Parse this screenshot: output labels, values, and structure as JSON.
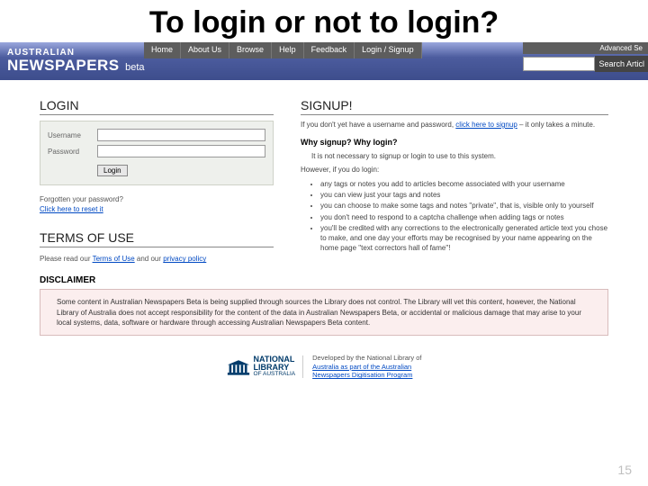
{
  "slide_title": "To login or not to login?",
  "brand": {
    "line1": "AUSTRALIAN",
    "line2": "NEWSPAPERS",
    "beta": "beta"
  },
  "nav": [
    "Home",
    "About Us",
    "Browse",
    "Help",
    "Feedback",
    "Login / Signup"
  ],
  "header_right": {
    "advanced": "Advanced Se",
    "search_btn": "Search Articl"
  },
  "login": {
    "title": "LOGIN",
    "username_label": "Username",
    "password_label": "Password",
    "login_btn": "Login",
    "forgot_q": "Forgotten your password?",
    "forgot_link": "Click here to reset it"
  },
  "terms": {
    "title": "TERMS OF USE",
    "prefix": "Please read our ",
    "link1": "Terms of Use",
    "mid": " and our ",
    "link2": "privacy policy"
  },
  "signup": {
    "title": "SIGNUP!",
    "intro_prefix": "If you don't yet have a username and password, ",
    "intro_link": "click here to signup",
    "intro_suffix": " – it only takes a minute.",
    "why_title": "Why signup? Why login?",
    "not_necessary": "It is not necessary to signup or login to use to this system.",
    "however": "However, if you do login:",
    "benefits": [
      "any tags or notes you add to articles become associated with your username",
      "you can view just your tags and notes",
      "you can choose to make some tags and notes \"private\", that is, visible only to yourself",
      "you don't need to respond to a captcha challenge when adding tags or notes",
      "you'll be credited with any corrections to the electronically generated article text you chose to make, and one day your efforts may be recognised by your name appearing on the home page \"text correctors hall of fame\"!"
    ]
  },
  "disclaimer": {
    "label": "DISCLAIMER",
    "text": "Some content in Australian Newspapers Beta is being supplied through sources the Library does not control. The Library will vet this content, however, the National Library of Australia does not accept responsibility for the content of the data in Australian Newspapers Beta, or accidental or malicious damage that may arise to your local systems, data, software or hardware through accessing Australian Newspapers Beta content."
  },
  "footer": {
    "logo_top": "NATIONAL",
    "logo_mid": "LIBRARY",
    "logo_bot": "OF AUSTRALIA",
    "dev_prefix": "Developed by the National Library of",
    "dev_link1": "Australia as part of the Australian",
    "dev_link2": "Newspapers Digitisation Program"
  },
  "page_num": "15"
}
